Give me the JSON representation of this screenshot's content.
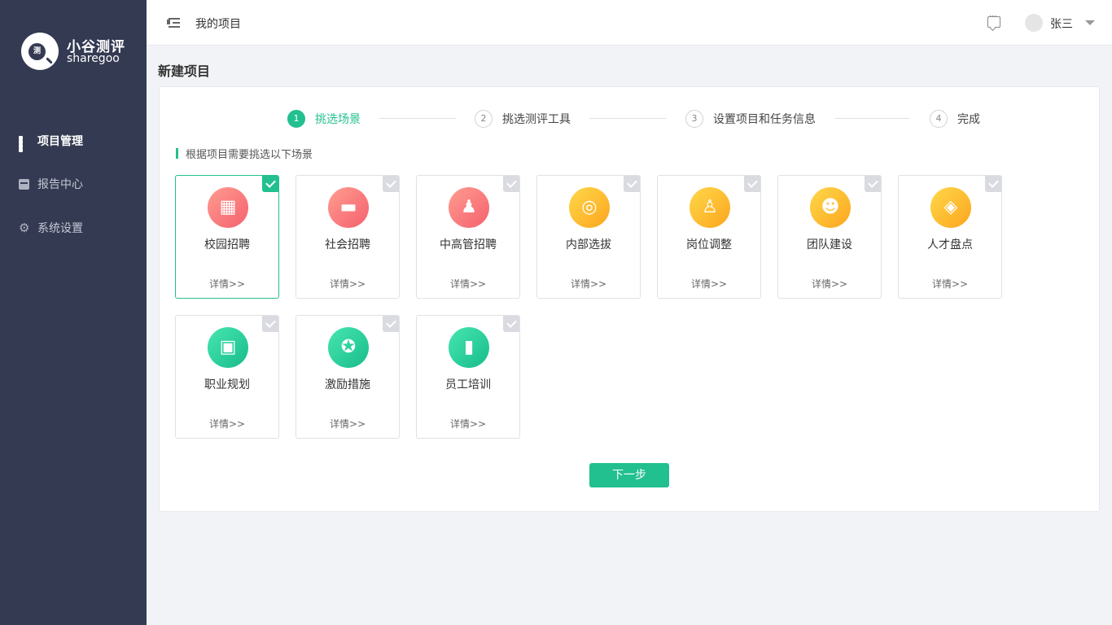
{
  "brand": {
    "name_cn": "小谷测评",
    "name_en": "sharegoo",
    "mark_glyph": "测"
  },
  "sidebar": {
    "items": [
      {
        "label": "项目管理",
        "icon": "grid-icon",
        "active": true
      },
      {
        "label": "报告中心",
        "icon": "report-box-icon",
        "active": false
      },
      {
        "label": "系统设置",
        "icon": "gear-icon",
        "active": false
      }
    ]
  },
  "header": {
    "title": "我的项目",
    "user_name": "张三"
  },
  "page": {
    "title": "新建项目",
    "section_title": "根据项目需要挑选以下场景"
  },
  "steps": [
    {
      "num": "1",
      "label": "挑选场景",
      "active": true
    },
    {
      "num": "2",
      "label": "挑选测评工具",
      "active": false
    },
    {
      "num": "3",
      "label": "设置项目和任务信息",
      "active": false
    },
    {
      "num": "4",
      "label": "完成",
      "active": false
    }
  ],
  "scenarios": [
    {
      "name": "校园招聘",
      "detail": "详情>>",
      "color": "red",
      "icon": "calendar-icon",
      "selected": true
    },
    {
      "name": "社会招聘",
      "detail": "详情>>",
      "color": "red",
      "icon": "briefcase-icon",
      "selected": false
    },
    {
      "name": "中高管招聘",
      "detail": "详情>>",
      "color": "red",
      "icon": "executive-icon",
      "selected": false
    },
    {
      "name": "内部选拔",
      "detail": "详情>>",
      "color": "yellow",
      "icon": "search-person-icon",
      "selected": false
    },
    {
      "name": "岗位调整",
      "detail": "详情>>",
      "color": "yellow",
      "icon": "person-transfer-icon",
      "selected": false
    },
    {
      "name": "团队建设",
      "detail": "详情>>",
      "color": "yellow",
      "icon": "team-icon",
      "selected": false
    },
    {
      "name": "人才盘点",
      "detail": "详情>>",
      "color": "yellow",
      "icon": "inventory-box-icon",
      "selected": false
    },
    {
      "name": "职业规划",
      "detail": "详情>>",
      "color": "green",
      "icon": "career-board-icon",
      "selected": false
    },
    {
      "name": "激励措施",
      "detail": "详情>>",
      "color": "green",
      "icon": "medal-icon",
      "selected": false
    },
    {
      "name": "员工培训",
      "detail": "详情>>",
      "color": "green",
      "icon": "training-book-icon",
      "selected": false
    }
  ],
  "actions": {
    "next_label": "下一步"
  },
  "colors": {
    "sidebar_bg": "#343a52",
    "accent": "#22c08f",
    "page_bg": "#f2f3f7"
  }
}
